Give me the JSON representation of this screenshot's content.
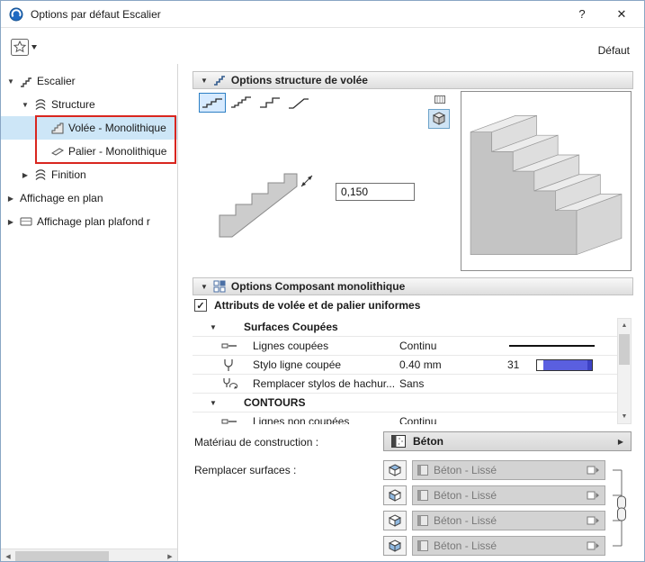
{
  "titlebar": {
    "title": "Options par défaut Escalier",
    "help_label": "?",
    "close_label": "✕"
  },
  "toolbar": {
    "default_label": "Défaut"
  },
  "icons": {
    "expand_arrow": "▼",
    "collapse_arrow": "▶",
    "section_arrow": "▼",
    "scroll_up": "▲",
    "scroll_down": "▼",
    "scroll_left": "◀",
    "scroll_right": "▶",
    "check": "✓",
    "dropdown_right": "▶"
  },
  "sidebar": {
    "items": [
      {
        "label": "Escalier"
      },
      {
        "label": "Structure"
      },
      {
        "label": "Volée - Monolithique"
      },
      {
        "label": "Palier - Monolithique"
      },
      {
        "label": "Finition"
      },
      {
        "label": "Affichage en plan"
      },
      {
        "label": "Affichage plan plafond r"
      }
    ]
  },
  "flight_panel": {
    "title": "Options structure de volée",
    "riser_height_value": "0,150"
  },
  "component_panel": {
    "title": "Options Composant monolithique",
    "uniform_attributes_label": "Attributs de volée et de palier uniformes",
    "rows": {
      "section1": "Surfaces Coupées",
      "r1_label": "Lignes coupées",
      "r1_value": "Continu",
      "r2_label": "Stylo ligne coupée",
      "r2_value": "0.40 mm",
      "r2_pen": "31",
      "r3_label": "Remplacer stylos de hachur...",
      "r3_value": "Sans",
      "section2": "CONTOURS",
      "r4_label": "Lignes non coupées",
      "r4_value": "Continu"
    }
  },
  "material": {
    "label": "Matériau de construction :",
    "value": "Béton"
  },
  "surfaces": {
    "label": "Remplacer surfaces :",
    "rows": [
      {
        "value": "Béton - Lissé"
      },
      {
        "value": "Béton - Lissé"
      },
      {
        "value": "Béton - Lissé"
      },
      {
        "value": "Béton - Lissé"
      }
    ]
  },
  "colors": {
    "selection_blue": "#cde6f7",
    "accent_blue": "#2d7fc4",
    "annotation_red": "#d9261f",
    "pen_swatch_blue": "#5a5fe0"
  }
}
